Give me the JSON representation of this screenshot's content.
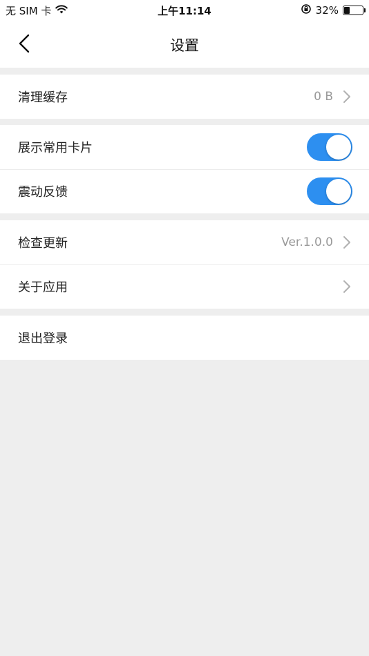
{
  "status_bar": {
    "carrier": "无 SIM 卡",
    "time": "上午11:14",
    "battery": "32%",
    "battery_level": 0.32
  },
  "nav": {
    "title": "设置",
    "back_icon": "chevron-left-icon"
  },
  "groups": [
    {
      "items": [
        {
          "label": "清理缓存",
          "value": "0 B",
          "type": "link"
        }
      ]
    },
    {
      "items": [
        {
          "label": "展示常用卡片",
          "type": "toggle",
          "on": true
        },
        {
          "label": "震动反馈",
          "type": "toggle",
          "on": true
        }
      ]
    },
    {
      "items": [
        {
          "label": "检查更新",
          "value": "Ver.1.0.0",
          "type": "link"
        },
        {
          "label": "关于应用",
          "value": "",
          "type": "link"
        }
      ]
    },
    {
      "items": [
        {
          "label": "退出登录",
          "type": "action"
        }
      ]
    }
  ],
  "colors": {
    "toggle_on": "#2d8ff0",
    "background": "#eeeeee",
    "secondary_text": "#999999"
  }
}
